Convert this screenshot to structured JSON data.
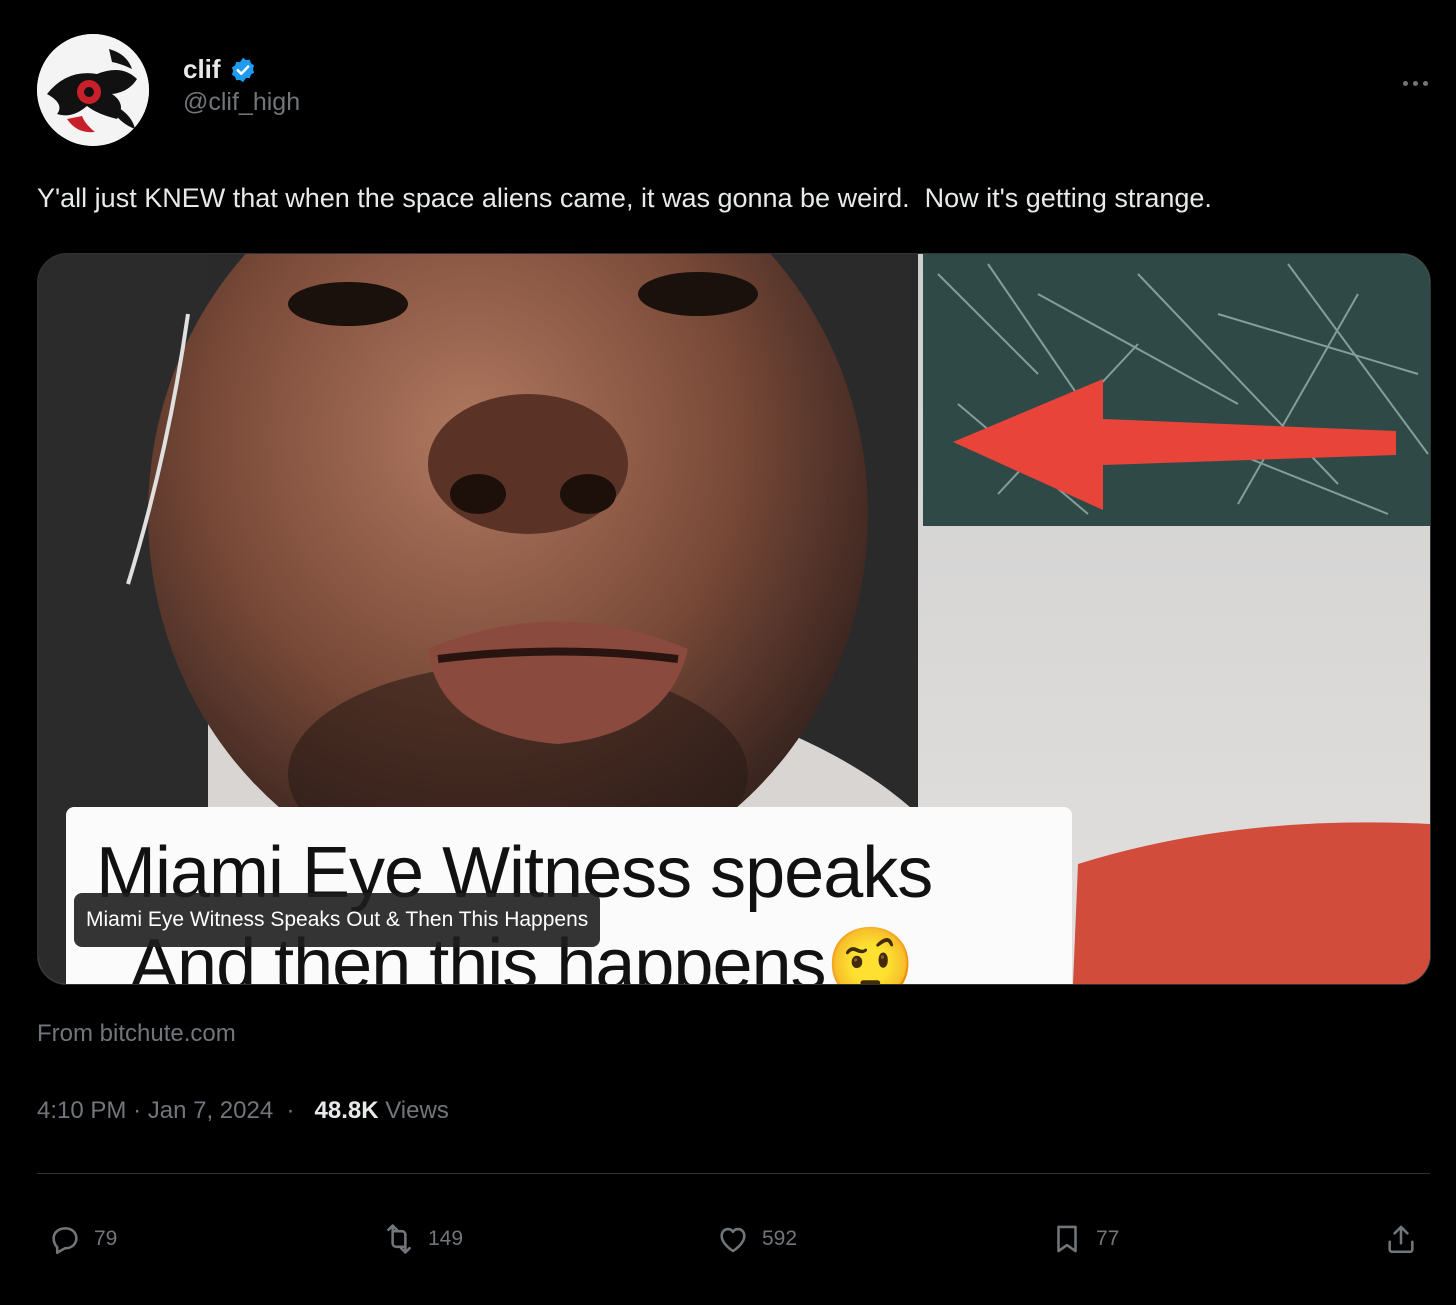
{
  "author": {
    "display_name": "clif",
    "handle": "@clif_high",
    "verified_icon": "verified-badge-icon",
    "verified_color": "#1d9bf0"
  },
  "tweet": {
    "text": "Y'all just KNEW that when the space aliens came, it was gonna be weird.  Now it's getting strange."
  },
  "media": {
    "caption_line1": "Miami Eye Witness speaks",
    "caption_line2": "And then this happens",
    "caption_emoji": "🤨",
    "title_overlay": "Miami Eye Witness Speaks Out & Then This Happens",
    "arrow_color": "#e8443a"
  },
  "source": "From bitchute.com",
  "meta": {
    "time": "4:10 PM",
    "date": "Jan 7, 2024",
    "views_count": "48.8K",
    "views_label": "Views"
  },
  "actions": {
    "replies": "79",
    "reposts": "149",
    "likes": "592",
    "bookmarks": "77"
  }
}
